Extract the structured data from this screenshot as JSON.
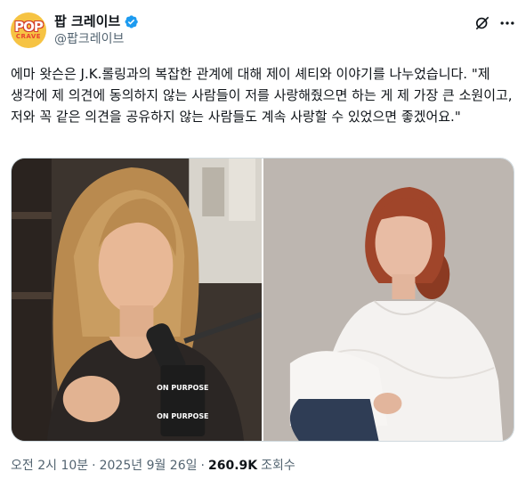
{
  "account": {
    "display_name": "팝 크레이브",
    "handle": "@팝크레이브",
    "avatar_text_top": "POP",
    "avatar_text_bottom": "CRAVE",
    "verified_color": "#1d9bf0"
  },
  "tweet": {
    "text": "에마 왓슨은 J.K.롤링과의 복잡한 관계에 대해 제이 셰티와 이야기를 나누었습니다. \"제 생각에 제 의견에 동의하지 않는 사람들이 저를 사랑해줬으면 하는 게 제 가장 큰 소원이고, 저와 꼭 같은 의견을 공유하지 않는 사람들도 계속 사랑할 수 있었으면 좋겠어요.\"",
    "time": "오전 2시 10분",
    "separator": "·",
    "date": "2025년 9월 26일",
    "views_count": "260.9K",
    "views_label": "조회수"
  },
  "media": {
    "left_photo_mic_text_top": "ON PURPOSE",
    "left_photo_mic_text_bottom": "ON PURPOSE"
  },
  "icons": [
    "grok-icon",
    "more-icon",
    "verified-icon"
  ]
}
